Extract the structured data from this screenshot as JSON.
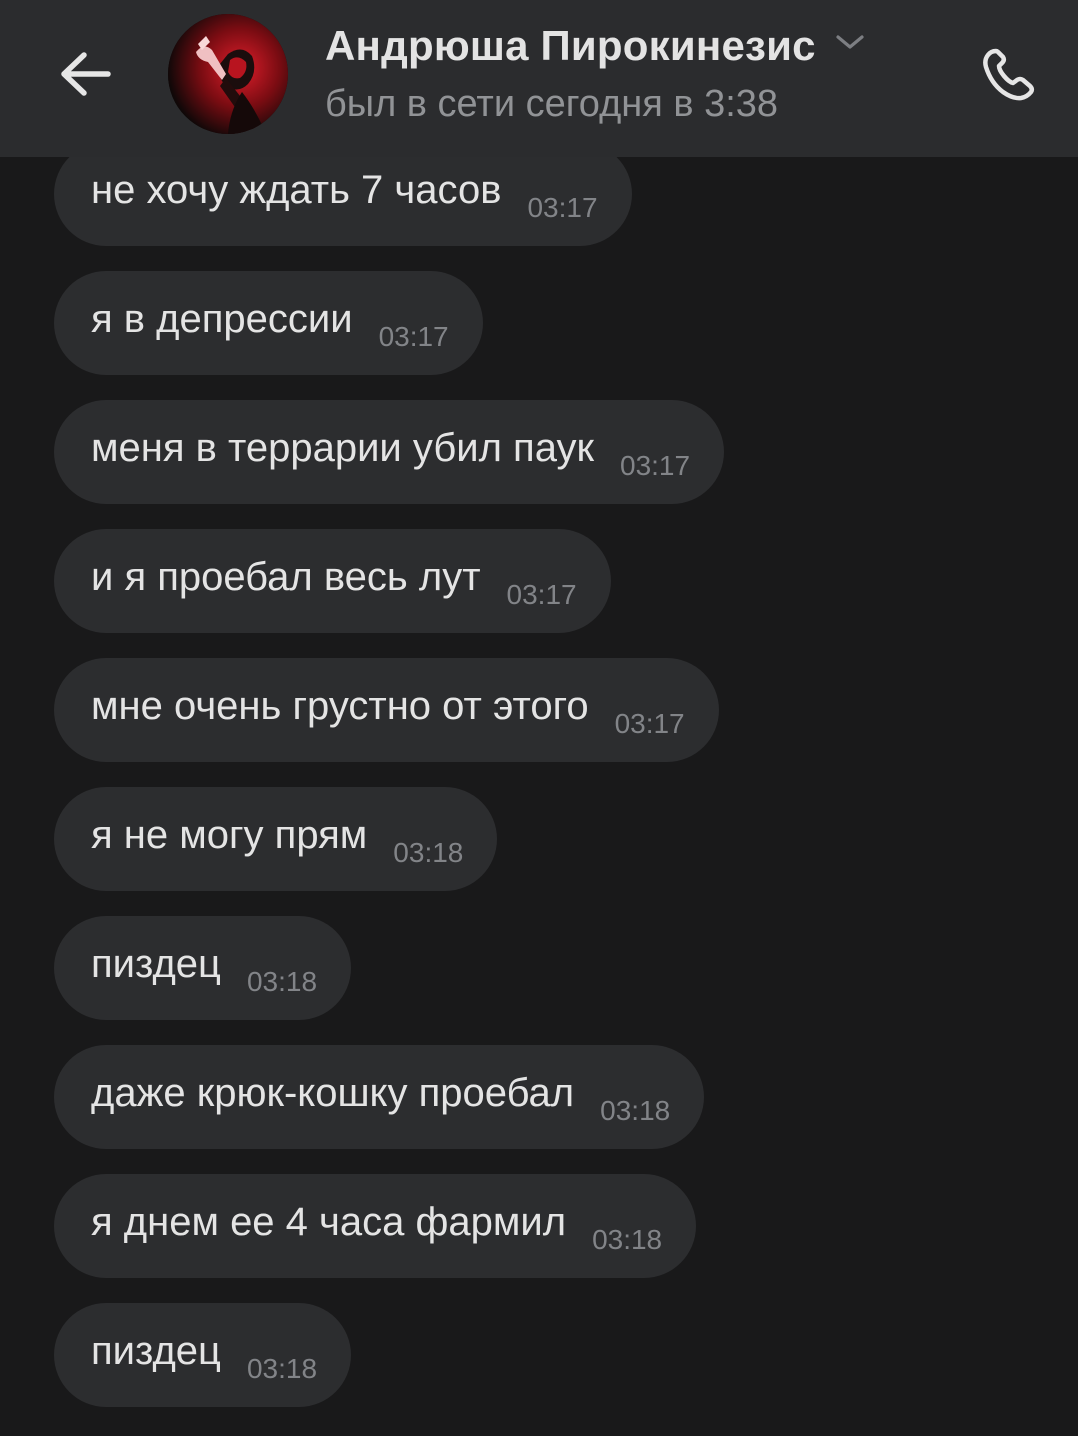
{
  "header": {
    "back_icon": "arrow-left-icon",
    "contact_name": "Андрюша Пирокинезис",
    "status": "был в сети сегодня в 3:38",
    "chevron_icon": "chevron-down-icon",
    "call_icon": "phone-icon",
    "accent_color": "#e01e2b"
  },
  "messages": [
    {
      "text": "не хочу ждать 7 часов",
      "time": "03:17"
    },
    {
      "text": "я в депрессии",
      "time": "03:17"
    },
    {
      "text": "меня в террарии убил паук",
      "time": "03:17"
    },
    {
      "text": "и я проебал весь лут",
      "time": "03:17"
    },
    {
      "text": "мне очень грустно от этого",
      "time": "03:17"
    },
    {
      "text": "я не могу прям",
      "time": "03:18"
    },
    {
      "text": "пиздец",
      "time": "03:18"
    },
    {
      "text": "даже крюк-кошку проебал",
      "time": "03:18"
    },
    {
      "text": "я днем ее 4 часа фармил",
      "time": "03:18"
    },
    {
      "text": "пиздец",
      "time": "03:18"
    }
  ]
}
